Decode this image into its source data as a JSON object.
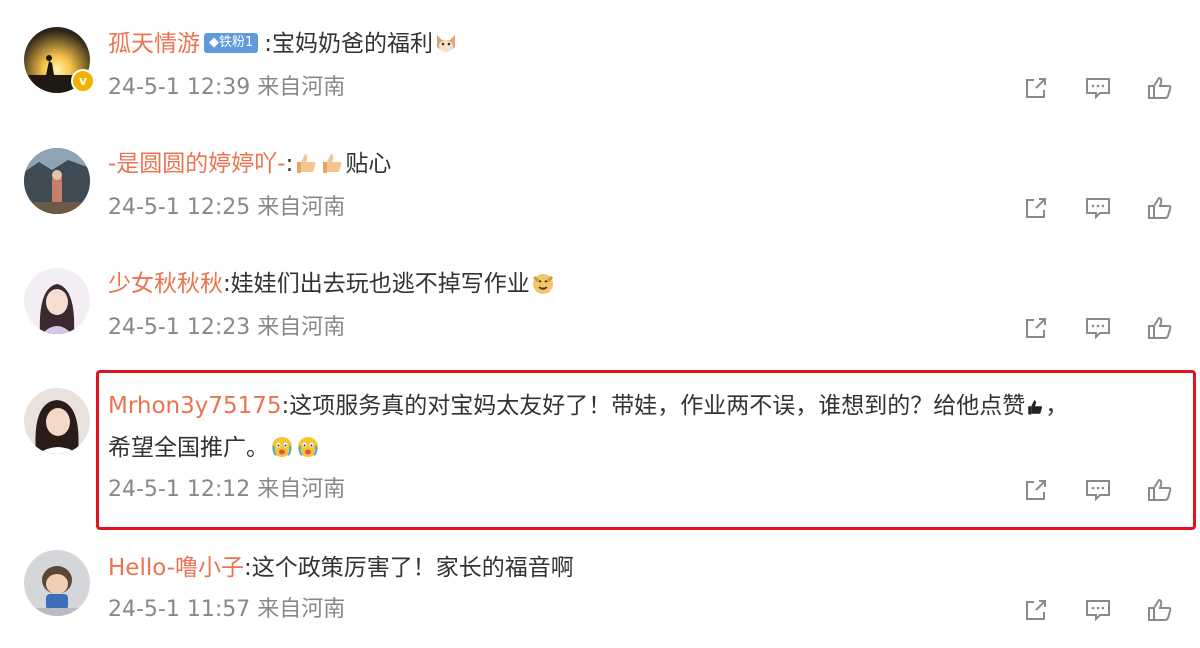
{
  "comments": [
    {
      "username": "孤天情游",
      "badge": "铁粉1",
      "text": ":宝妈奶爸的福利",
      "emoji": "cat-face-emoji",
      "verified": true,
      "time": "24-5-1 12:39",
      "source": "来自河南"
    },
    {
      "username": "-是圆圆的婷婷吖-",
      "text_prefix": ":",
      "text": "贴心",
      "emoji": "thumbs-up-emoji",
      "time": "24-5-1 12:25",
      "source": "来自河南"
    },
    {
      "username": "少女秋秋秋",
      "text": ":娃娃们出去玩也逃不掉写作业",
      "emoji": "smiling-dog-emoji",
      "time": "24-5-1 12:23",
      "source": "来自河南"
    },
    {
      "username": "Mrhon3y75175",
      "text_line1": ":这项服务真的对宝妈太友好了！带娃，作业两不误，谁想到的？给他点赞",
      "text_line1_end": "，",
      "text_line2": "希望全国推广。",
      "emoji": "crying-face-emoji",
      "time": "24-5-1 12:12",
      "source": "来自河南",
      "highlighted": true
    },
    {
      "username": "Hello-噜小子",
      "text": ":这个政策厉害了！家长的福音啊",
      "time": "24-5-1 11:57",
      "source": "来自河南"
    }
  ],
  "icons": [
    "share-icon",
    "comment-icon",
    "like-icon"
  ],
  "colors": {
    "username": "#eb7350",
    "meta": "#888888",
    "highlight_border": "#e0141e",
    "badge": "#5d9bdc"
  }
}
